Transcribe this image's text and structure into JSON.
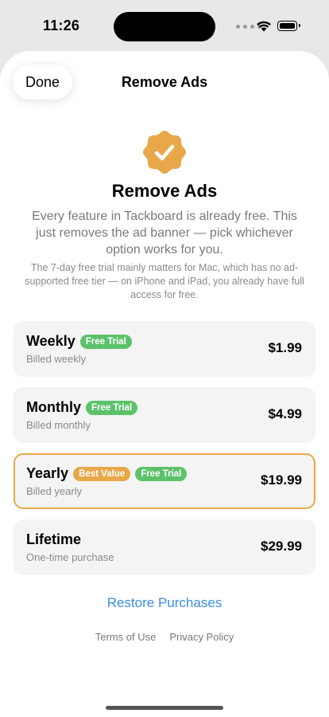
{
  "status_bar": {
    "time": "11:26"
  },
  "header": {
    "done_label": "Done",
    "title": "Remove Ads"
  },
  "hero": {
    "icon": "checkmark-seal-icon",
    "title": "Remove Ads",
    "description": "Every feature in Tackboard is already free. This just removes the ad banner — pick whichever option works for you.",
    "note": "The 7-day free trial mainly matters for Mac, which has no ad-supported free tier — on iPhone and iPad, you already have full access for free."
  },
  "plans": [
    {
      "name": "Weekly",
      "badges": [
        "Free Trial"
      ],
      "subtitle": "Billed weekly",
      "price": "$1.99",
      "selected": false
    },
    {
      "name": "Monthly",
      "badges": [
        "Free Trial"
      ],
      "subtitle": "Billed monthly",
      "price": "$4.99",
      "selected": false
    },
    {
      "name": "Yearly",
      "badges": [
        "Best Value",
        "Free Trial"
      ],
      "subtitle": "Billed yearly",
      "price": "$19.99",
      "selected": true
    },
    {
      "name": "Lifetime",
      "badges": [],
      "subtitle": "One-time purchase",
      "price": "$29.99",
      "selected": false
    }
  ],
  "restore_label": "Restore Purchases",
  "footer": {
    "terms_label": "Terms of Use",
    "privacy_label": "Privacy Policy"
  },
  "colors": {
    "accent_orange": "#e8a84a",
    "badge_green": "#5cc26a",
    "link_blue": "#3a8ee6"
  }
}
